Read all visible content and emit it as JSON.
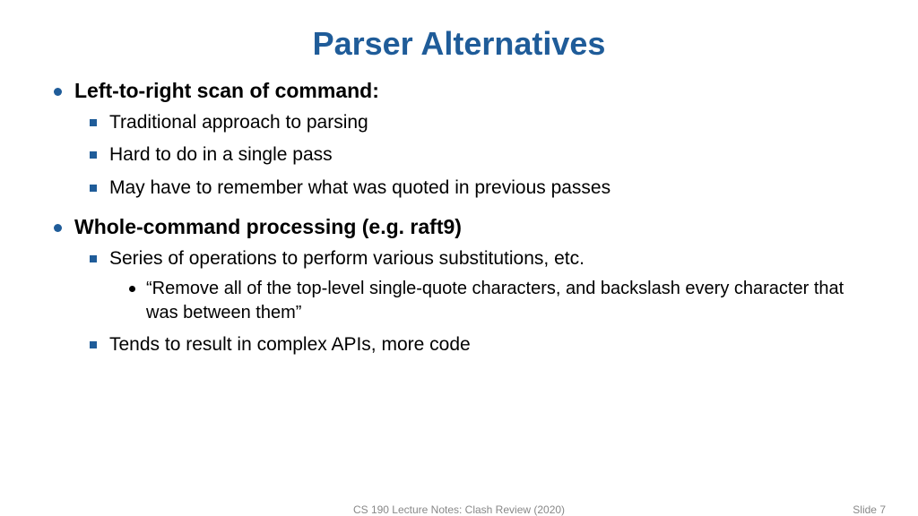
{
  "title": "Parser Alternatives",
  "sections": [
    {
      "heading": "Left-to-right scan of command:",
      "items": [
        {
          "text": "Traditional approach to parsing"
        },
        {
          "text": "Hard to do in a single pass"
        },
        {
          "text": "May have to remember what was quoted in previous passes"
        }
      ]
    },
    {
      "heading": "Whole-command processing (e.g. raft9)",
      "items": [
        {
          "text": "Series of operations to perform various substitutions, etc.",
          "subitems": [
            {
              "text": "“Remove all of the top-level single-quote characters, and backslash every character that was between them”"
            }
          ]
        },
        {
          "text": "Tends to result in complex APIs, more code"
        }
      ]
    }
  ],
  "footer": {
    "center": "CS 190 Lecture Notes: Clash Review (2020)",
    "right": "Slide 7"
  }
}
